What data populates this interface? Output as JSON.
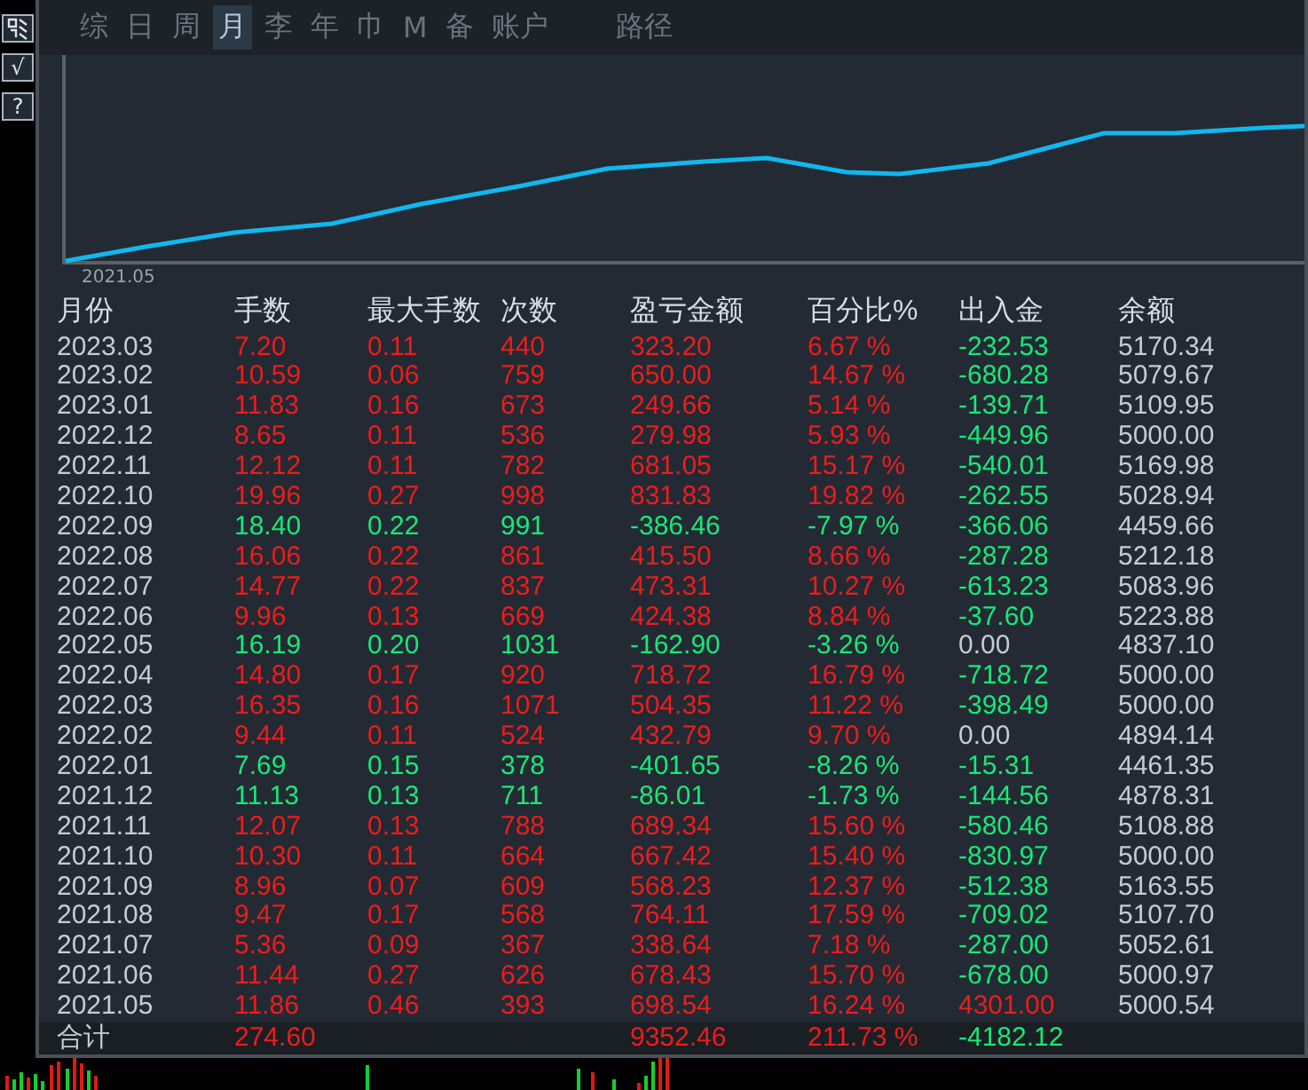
{
  "side_buttons": [
    {
      "kind": "icon"
    },
    {
      "kind": "text",
      "label": "√"
    },
    {
      "kind": "text",
      "label": "?"
    }
  ],
  "tabs": [
    {
      "label": "综",
      "selected": false
    },
    {
      "label": "日",
      "selected": false
    },
    {
      "label": "周",
      "selected": false
    },
    {
      "label": "月",
      "selected": true
    },
    {
      "label": "李",
      "selected": false
    },
    {
      "label": "年",
      "selected": false
    },
    {
      "label": "巾",
      "selected": false
    },
    {
      "label": "M",
      "selected": false
    },
    {
      "label": "备",
      "selected": false
    },
    {
      "label": "账户",
      "selected": false
    },
    {
      "label": "路径",
      "selected": false
    }
  ],
  "chart": {
    "start_label": "2021.05"
  },
  "table": {
    "columns": [
      "月份",
      "手数",
      "最大手数",
      "次数",
      "盈亏金额",
      "百分比%",
      "出入金",
      "余额"
    ],
    "rows": [
      {
        "loss": false,
        "deposit": false,
        "withdrawal": true,
        "cells": [
          "2023.03",
          "7.20",
          "0.11",
          "440",
          "323.20",
          "6.67 %",
          "-232.53",
          "5170.34"
        ]
      },
      {
        "loss": false,
        "deposit": false,
        "withdrawal": true,
        "cells": [
          "2023.02",
          "10.59",
          "0.06",
          "759",
          "650.00",
          "14.67 %",
          "-680.28",
          "5079.67"
        ]
      },
      {
        "loss": false,
        "deposit": false,
        "withdrawal": true,
        "cells": [
          "2023.01",
          "11.83",
          "0.16",
          "673",
          "249.66",
          "5.14 %",
          "-139.71",
          "5109.95"
        ]
      },
      {
        "loss": false,
        "deposit": false,
        "withdrawal": true,
        "cells": [
          "2022.12",
          "8.65",
          "0.11",
          "536",
          "279.98",
          "5.93 %",
          "-449.96",
          "5000.00"
        ]
      },
      {
        "loss": false,
        "deposit": false,
        "withdrawal": true,
        "cells": [
          "2022.11",
          "12.12",
          "0.11",
          "782",
          "681.05",
          "15.17 %",
          "-540.01",
          "5169.98"
        ]
      },
      {
        "loss": false,
        "deposit": false,
        "withdrawal": true,
        "cells": [
          "2022.10",
          "19.96",
          "0.27",
          "998",
          "831.83",
          "19.82 %",
          "-262.55",
          "5028.94"
        ]
      },
      {
        "loss": true,
        "deposit": false,
        "withdrawal": true,
        "cells": [
          "2022.09",
          "18.40",
          "0.22",
          "991",
          "-386.46",
          "-7.97 %",
          "-366.06",
          "4459.66"
        ]
      },
      {
        "loss": false,
        "deposit": false,
        "withdrawal": true,
        "cells": [
          "2022.08",
          "16.06",
          "0.22",
          "861",
          "415.50",
          "8.66 %",
          "-287.28",
          "5212.18"
        ]
      },
      {
        "loss": false,
        "deposit": false,
        "withdrawal": true,
        "cells": [
          "2022.07",
          "14.77",
          "0.22",
          "837",
          "473.31",
          "10.27 %",
          "-613.23",
          "5083.96"
        ]
      },
      {
        "loss": false,
        "deposit": false,
        "withdrawal": true,
        "cells": [
          "2022.06",
          "9.96",
          "0.13",
          "669",
          "424.38",
          "8.84 %",
          "-37.60",
          "5223.88"
        ]
      },
      {
        "loss": true,
        "deposit": false,
        "withdrawal": false,
        "cells": [
          "2022.05",
          "16.19",
          "0.20",
          "1031",
          "-162.90",
          "-3.26 %",
          "0.00",
          "4837.10"
        ]
      },
      {
        "loss": false,
        "deposit": false,
        "withdrawal": true,
        "cells": [
          "2022.04",
          "14.80",
          "0.17",
          "920",
          "718.72",
          "16.79 %",
          "-718.72",
          "5000.00"
        ]
      },
      {
        "loss": false,
        "deposit": false,
        "withdrawal": true,
        "cells": [
          "2022.03",
          "16.35",
          "0.16",
          "1071",
          "504.35",
          "11.22 %",
          "-398.49",
          "5000.00"
        ]
      },
      {
        "loss": false,
        "deposit": false,
        "withdrawal": false,
        "cells": [
          "2022.02",
          "9.44",
          "0.11",
          "524",
          "432.79",
          "9.70 %",
          "0.00",
          "4894.14"
        ]
      },
      {
        "loss": true,
        "deposit": false,
        "withdrawal": true,
        "cells": [
          "2022.01",
          "7.69",
          "0.15",
          "378",
          "-401.65",
          "-8.26 %",
          "-15.31",
          "4461.35"
        ]
      },
      {
        "loss": true,
        "deposit": false,
        "withdrawal": true,
        "cells": [
          "2021.12",
          "11.13",
          "0.13",
          "711",
          "-86.01",
          "-1.73 %",
          "-144.56",
          "4878.31"
        ]
      },
      {
        "loss": false,
        "deposit": false,
        "withdrawal": true,
        "cells": [
          "2021.11",
          "12.07",
          "0.13",
          "788",
          "689.34",
          "15.60 %",
          "-580.46",
          "5108.88"
        ]
      },
      {
        "loss": false,
        "deposit": false,
        "withdrawal": true,
        "cells": [
          "2021.10",
          "10.30",
          "0.11",
          "664",
          "667.42",
          "15.40 %",
          "-830.97",
          "5000.00"
        ]
      },
      {
        "loss": false,
        "deposit": false,
        "withdrawal": true,
        "cells": [
          "2021.09",
          "8.96",
          "0.07",
          "609",
          "568.23",
          "12.37 %",
          "-512.38",
          "5163.55"
        ]
      },
      {
        "loss": false,
        "deposit": false,
        "withdrawal": true,
        "cells": [
          "2021.08",
          "9.47",
          "0.17",
          "568",
          "764.11",
          "17.59 %",
          "-709.02",
          "5107.70"
        ]
      },
      {
        "loss": false,
        "deposit": false,
        "withdrawal": true,
        "cells": [
          "2021.07",
          "5.36",
          "0.09",
          "367",
          "338.64",
          "7.18 %",
          "-287.00",
          "5052.61"
        ]
      },
      {
        "loss": false,
        "deposit": false,
        "withdrawal": true,
        "cells": [
          "2021.06",
          "11.44",
          "0.27",
          "626",
          "678.43",
          "15.70 %",
          "-678.00",
          "5000.97"
        ]
      },
      {
        "loss": false,
        "deposit": true,
        "withdrawal": false,
        "cells": [
          "2021.05",
          "11.86",
          "0.46",
          "393",
          "698.54",
          "16.24 %",
          "4301.00",
          "5000.54"
        ]
      }
    ],
    "total": {
      "loss": false,
      "deposit": false,
      "withdrawal": true,
      "label": "合计",
      "lots": "274.60",
      "profit": "9352.46",
      "percent": "211.73 %",
      "cash_flow": "-4182.12"
    }
  }
}
